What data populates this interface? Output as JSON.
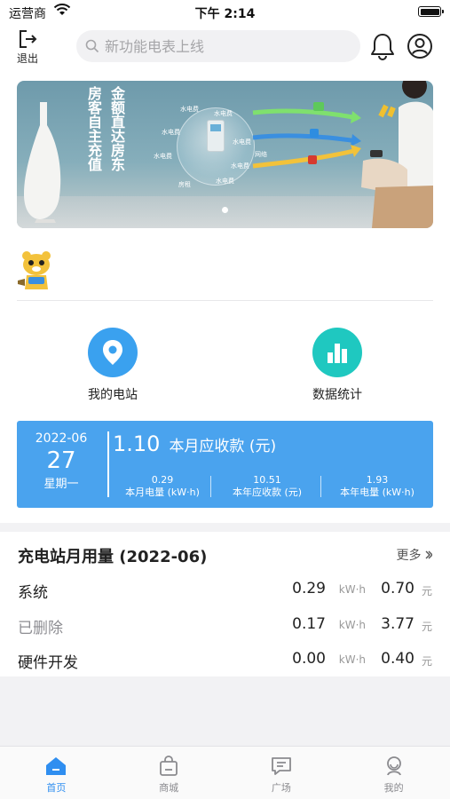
{
  "status_bar": {
    "carrier": "运营商",
    "time": "下午 2:14"
  },
  "header": {
    "logout_label": "退出",
    "search_placeholder": "新功能电表上线"
  },
  "banner": {
    "text_col1": "房客自主充值",
    "text_col2": "金额直达房东",
    "labels": [
      "水电费",
      "水电费",
      "水电费",
      "水电费",
      "水电费",
      "水电费",
      "网络",
      "房租",
      "水电费"
    ]
  },
  "features": [
    {
      "label": "我的电站",
      "icon": "location-pin-icon",
      "color": "#3aa1ef"
    },
    {
      "label": "数据统计",
      "icon": "bar-chart-icon",
      "color": "#1fc8c0"
    }
  ],
  "summary_card": {
    "year_month": "2022-06",
    "day": "27",
    "weekday": "星期一",
    "main_value": "1.10",
    "main_label": "本月应收款 (元)",
    "stats": [
      {
        "value": "0.29",
        "label": "本月电量 (kW·h)"
      },
      {
        "value": "10.51",
        "label": "本年应收款 (元)"
      },
      {
        "value": "1.93",
        "label": "本年电量 (kW·h)"
      }
    ]
  },
  "monthly": {
    "title": "充电站月用量 (2022-06)",
    "more": "更多",
    "rows": [
      {
        "name": "系统",
        "kwh": "0.29",
        "kwh_unit": "kW·h",
        "amount": "0.70",
        "amount_unit": "元",
        "muted": false
      },
      {
        "name": "已删除",
        "kwh": "0.17",
        "kwh_unit": "kW·h",
        "amount": "3.77",
        "amount_unit": "元",
        "muted": true
      },
      {
        "name": "硬件开发",
        "kwh": "0.00",
        "kwh_unit": "kW·h",
        "amount": "0.40",
        "amount_unit": "元",
        "muted": false
      }
    ]
  },
  "tabbar": [
    {
      "label": "首页",
      "icon": "home-icon",
      "active": true
    },
    {
      "label": "商城",
      "icon": "shopping-bag-icon",
      "active": false
    },
    {
      "label": "广场",
      "icon": "chat-bubble-icon",
      "active": false
    },
    {
      "label": "我的",
      "icon": "profile-icon",
      "active": false
    }
  ],
  "colors": {
    "accent": "#2f8ef0",
    "card_bg": "#4aa3ee",
    "teal": "#1fc8c0"
  }
}
